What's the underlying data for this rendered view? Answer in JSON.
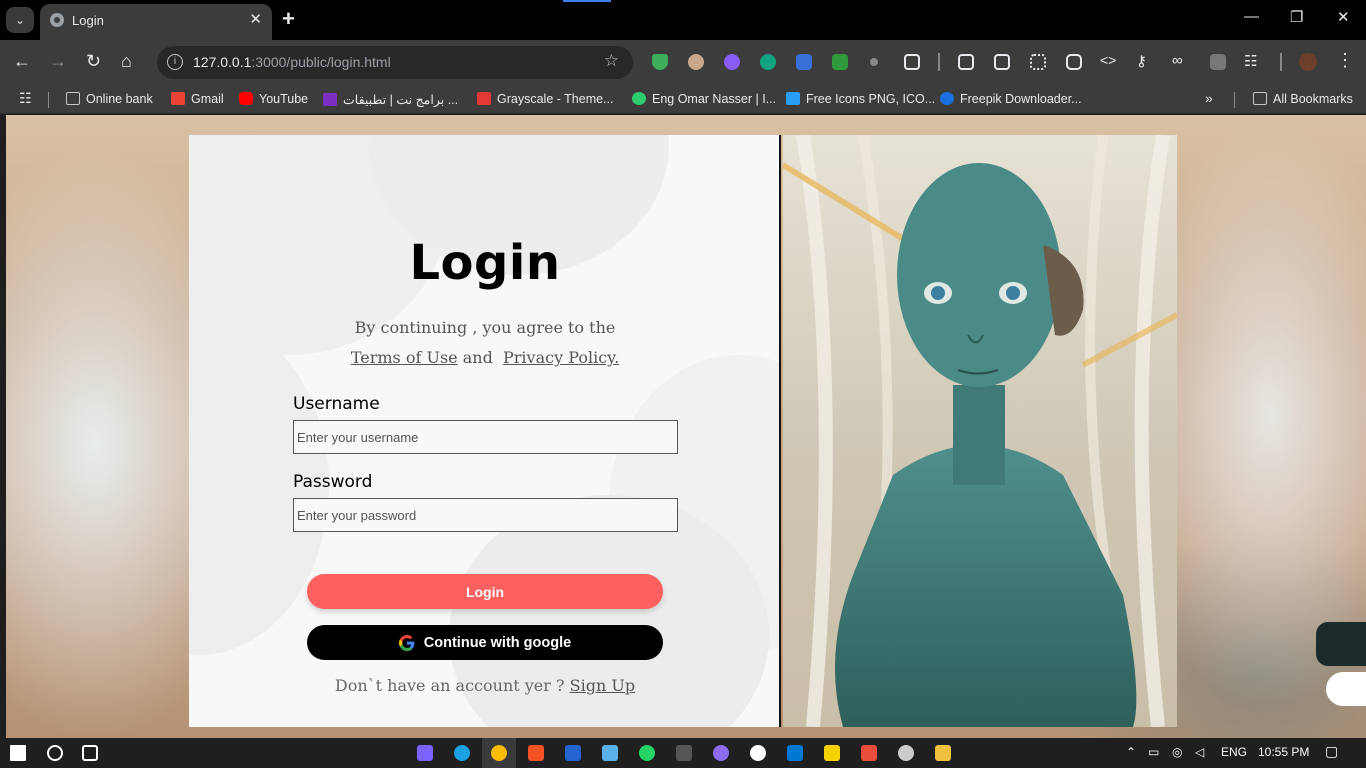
{
  "browser": {
    "tab_title": "Login",
    "url_host": "127.0.0.1",
    "url_rest": ":3000/public/login.html"
  },
  "bookmarks": [
    {
      "label": "Online bank",
      "icon": "folder-icon"
    },
    {
      "label": "Gmail",
      "icon": "gmail-icon"
    },
    {
      "label": "YouTube",
      "icon": "youtube-icon"
    },
    {
      "label": "برامج نت | تطبيقات ...",
      "icon": "pn-icon"
    },
    {
      "label": "Grayscale - Theme...",
      "icon": "grayscale-icon"
    },
    {
      "label": "Eng Omar Nasser | I...",
      "icon": "snowflake-icon"
    },
    {
      "label": "Free Icons PNG, ICO...",
      "icon": "icons-icon"
    },
    {
      "label": "Freepik Downloader...",
      "icon": "freepik-icon"
    }
  ],
  "all_bookmarks": "All Bookmarks",
  "login": {
    "title": "Login",
    "agree_text": "By continuing , you agree to the",
    "terms_link": "Terms of Use",
    "and_text": "and",
    "privacy_link": "Privacy Policy.",
    "username_label": "Username",
    "username_placeholder": "Enter your username",
    "password_label": "Password",
    "password_placeholder": "Enter your password",
    "login_button": "Login",
    "google_button": "Continue with google",
    "signup_prompt": "Don`t have an account yer ?",
    "signup_link": "Sign Up"
  },
  "taskbar": {
    "language": "ENG",
    "time": "10:55 PM"
  },
  "colors": {
    "login_button": "#fe5f5f",
    "google_button": "#000000",
    "card_left": "#f8f8f8"
  }
}
